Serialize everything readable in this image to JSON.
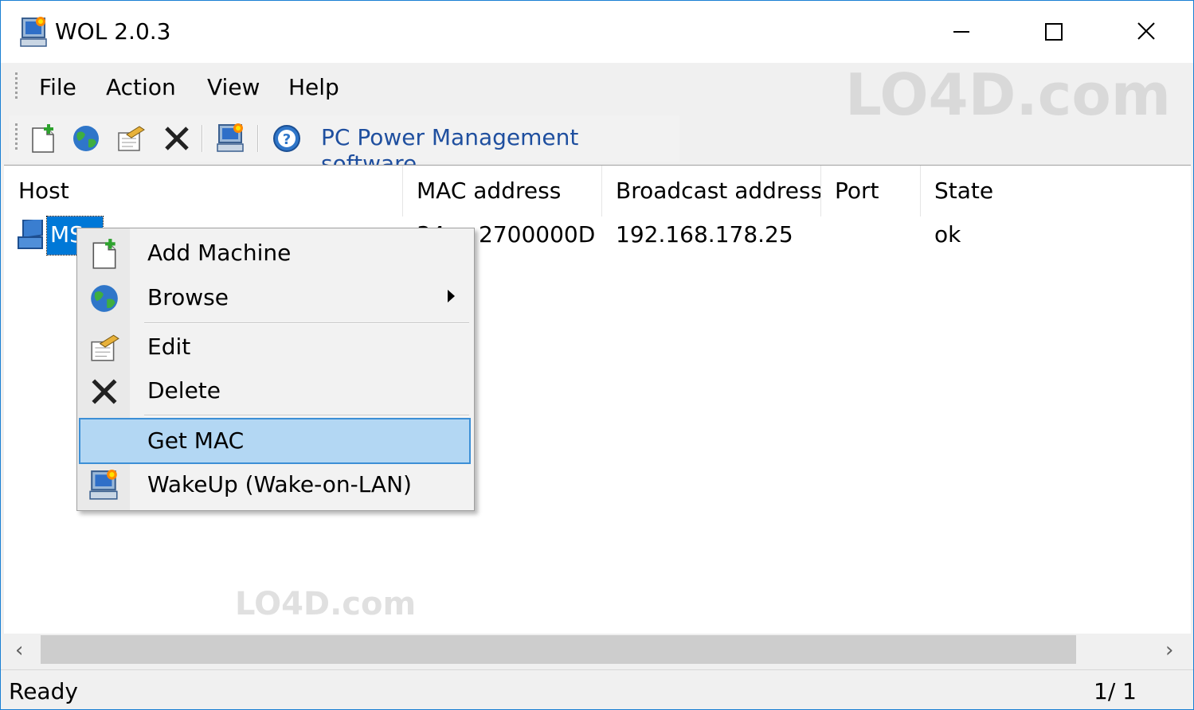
{
  "window": {
    "title": "WOL 2.0.3",
    "app_icon": "computer-wake-icon",
    "controls": [
      "minimize",
      "maximize",
      "close"
    ]
  },
  "menubar": {
    "items": [
      "File",
      "Action",
      "View",
      "Help"
    ]
  },
  "toolbar": {
    "buttons": [
      "add-machine-icon",
      "browse-globe-icon",
      "edit-icon",
      "delete-icon",
      "wakeup-icon",
      "help-icon"
    ],
    "link_text": "PC Power Management software"
  },
  "list": {
    "columns": [
      "Host",
      "MAC address",
      "Broadcast address",
      "Port",
      "State"
    ],
    "rows": [
      {
        "host": "MS",
        "mac": "2700000D",
        "mac_prefix": "34.",
        "broadcast": "192.168.178.25",
        "port": "",
        "state": "ok"
      }
    ]
  },
  "context_menu": {
    "items": [
      {
        "label": "Add Machine",
        "icon": "add-machine-icon"
      },
      {
        "label": "Browse",
        "icon": "browse-globe-icon",
        "submenu": true
      },
      {
        "label": "Edit",
        "icon": "edit-icon"
      },
      {
        "label": "Delete",
        "icon": "delete-icon"
      },
      {
        "label": "Get MAC",
        "icon": "",
        "highlighted": true
      },
      {
        "label": "WakeUp (Wake-on-LAN)",
        "icon": "wakeup-icon"
      }
    ]
  },
  "statusbar": {
    "text": "Ready",
    "page": "1/  1"
  },
  "watermark": "LO4D.com",
  "colors": {
    "accent": "#0078d7",
    "highlight": "#b3d7f3",
    "link": "#1f4f9f",
    "border": "#1a7fd3"
  }
}
